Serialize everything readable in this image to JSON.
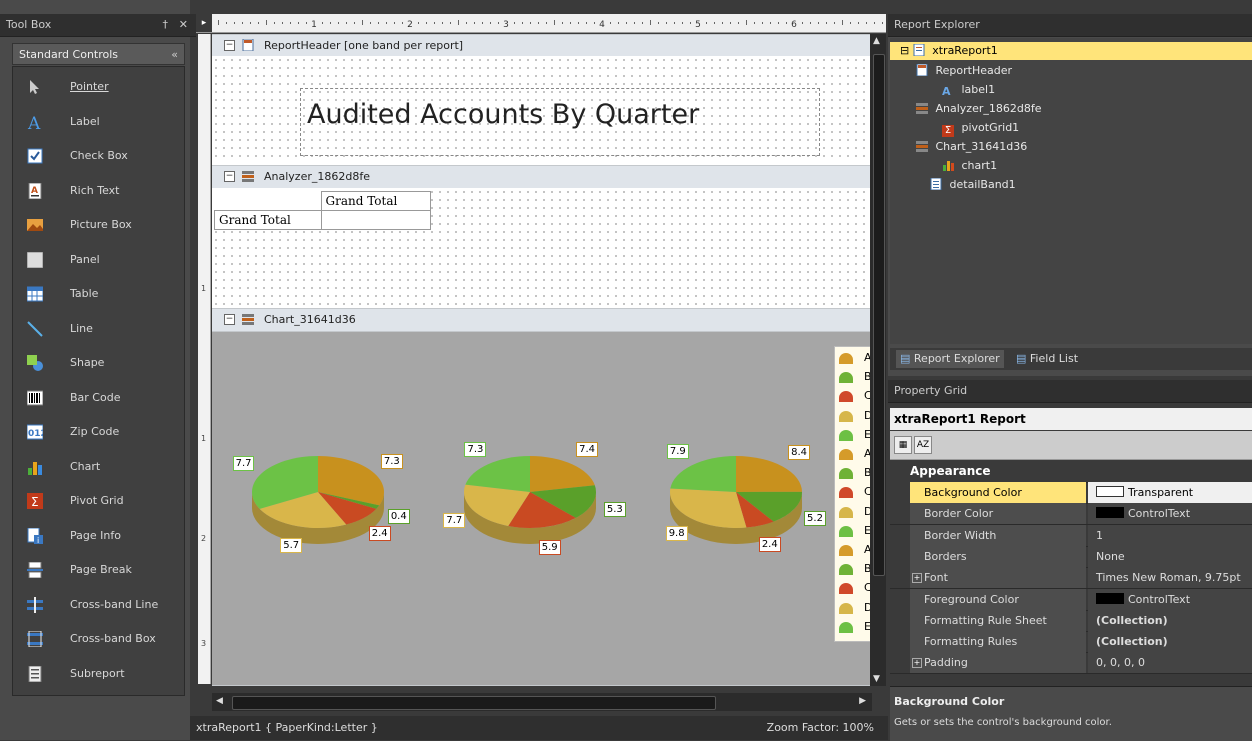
{
  "toolbox": {
    "title": "Tool Box",
    "pin": "†",
    "close": "✕",
    "group": "Standard Controls",
    "group_chevron": "«",
    "items": [
      {
        "label": "Pointer",
        "icon": "pointer-icon"
      },
      {
        "label": "Label",
        "icon": "label-icon"
      },
      {
        "label": "Check Box",
        "icon": "checkbox-icon"
      },
      {
        "label": "Rich Text",
        "icon": "richtext-icon"
      },
      {
        "label": "Picture Box",
        "icon": "picture-icon"
      },
      {
        "label": "Panel",
        "icon": "panel-icon"
      },
      {
        "label": "Table",
        "icon": "table-icon"
      },
      {
        "label": "Line",
        "icon": "line-icon"
      },
      {
        "label": "Shape",
        "icon": "shape-icon"
      },
      {
        "label": "Bar Code",
        "icon": "barcode-icon"
      },
      {
        "label": "Zip Code",
        "icon": "zipcode-icon"
      },
      {
        "label": "Chart",
        "icon": "chart-icon"
      },
      {
        "label": "Pivot Grid",
        "icon": "pivotgrid-icon"
      },
      {
        "label": "Page Info",
        "icon": "pageinfo-icon"
      },
      {
        "label": "Page Break",
        "icon": "pagebreak-icon"
      },
      {
        "label": "Cross-band Line",
        "icon": "crossband-line-icon"
      },
      {
        "label": "Cross-band Box",
        "icon": "crossband-box-icon"
      },
      {
        "label": "Subreport",
        "icon": "subreport-icon"
      }
    ]
  },
  "designer": {
    "ruler_numbers": [
      "1",
      "2",
      "3",
      "4",
      "5",
      "6"
    ],
    "vruler_numbers": [
      "1",
      "1",
      "2",
      "3"
    ],
    "bands": {
      "header": "ReportHeader [one band per report]",
      "analyzer": "Analyzer_1862d8fe",
      "chart": "Chart_31641d36",
      "detail": "detailBand1"
    },
    "report_title": "Audited Accounts By Quarter",
    "pivot": {
      "col_header": "Grand Total",
      "row_header": "Grand Total"
    },
    "legend_letters": [
      "A",
      "B",
      "C",
      "D",
      "E",
      "A",
      "B",
      "C",
      "D",
      "E",
      "A",
      "B",
      "C",
      "D",
      "E"
    ],
    "legend_colors": [
      "#d59b2a",
      "#6fb236",
      "#d0492a",
      "#d6b64a",
      "#6dc044",
      "#d59b2a",
      "#6fb236",
      "#d0492a",
      "#d6b64a",
      "#6dc044",
      "#d59b2a",
      "#6fb236",
      "#d0492a",
      "#d6b64a",
      "#6dc044"
    ]
  },
  "chart_data": {
    "type": "pie",
    "title": "",
    "series": [
      {
        "categories": [
          "A",
          "B",
          "C",
          "D",
          "E"
        ],
        "values": [
          7.3,
          0.4,
          2.4,
          5.7,
          7.7
        ],
        "colors": [
          "#c8911e",
          "#5aa02a",
          "#c94a22",
          "#d9b64a",
          "#6cc246"
        ]
      },
      {
        "categories": [
          "A",
          "B",
          "C",
          "D",
          "E"
        ],
        "values": [
          7.4,
          5.3,
          5.9,
          7.7,
          7.3
        ],
        "colors": [
          "#c8911e",
          "#5aa02a",
          "#c94a22",
          "#d9b64a",
          "#6cc246"
        ]
      },
      {
        "categories": [
          "A",
          "B",
          "C",
          "D",
          "E"
        ],
        "values": [
          8.4,
          5.2,
          2.4,
          9.8,
          7.9
        ],
        "colors": [
          "#c8911e",
          "#5aa02a",
          "#c94a22",
          "#d9b64a",
          "#6cc246"
        ]
      }
    ]
  },
  "status": {
    "left": "xtraReport1 { PaperKind:Letter }",
    "right": "Zoom Factor: 100%"
  },
  "explorer": {
    "title": "Report Explorer",
    "nodes": [
      "xtraReport1",
      "ReportHeader",
      "label1",
      "Analyzer_1862d8fe",
      "pivotGrid1",
      "Chart_31641d36",
      "chart1",
      "detailBand1"
    ],
    "tabs": [
      "Report Explorer",
      "Field List"
    ]
  },
  "propgrid": {
    "title": "Property Grid",
    "object": "xtraReport1  Report",
    "category": "Appearance",
    "rows": [
      {
        "name": "Background Color",
        "value": "Transparent",
        "swatch": "#ffffff"
      },
      {
        "name": "Border Color",
        "value": "ControlText",
        "swatch": "#000000"
      },
      {
        "name": "Border Width",
        "value": "1"
      },
      {
        "name": "Borders",
        "value": "None"
      },
      {
        "name": "Font",
        "value": "Times New Roman, 9.75pt",
        "expand": "+"
      },
      {
        "name": "Foreground Color",
        "value": "ControlText",
        "swatch": "#000000"
      },
      {
        "name": "Formatting Rule Sheet",
        "value": "(Collection)"
      },
      {
        "name": "Formatting Rules",
        "value": "(Collection)"
      },
      {
        "name": "Padding",
        "value": "0, 0, 0, 0",
        "expand": "+"
      }
    ],
    "desc_title": "Background Color",
    "desc_text": "Gets or sets the control's background color."
  }
}
